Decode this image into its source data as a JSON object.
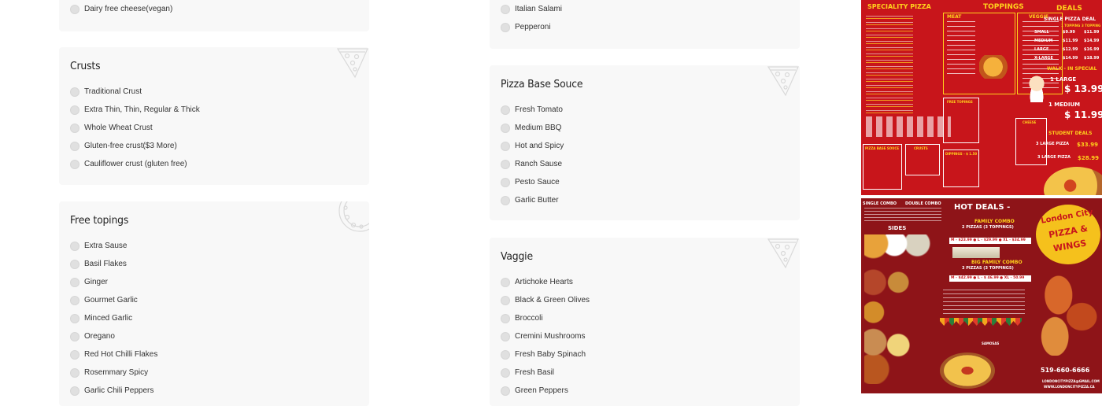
{
  "left_column": {
    "top_partial_option": "Dairy free cheese(vegan)",
    "crusts": {
      "title": "Crusts",
      "options": [
        "Traditional Crust",
        "Extra Thin, Thin, Regular & Thick",
        "Whole Wheat Crust",
        "Gluten-free crust($3 More)",
        "Cauliflower crust (gluten free)"
      ]
    },
    "free_toppings": {
      "title": "Free topings",
      "options": [
        "Extra Sause",
        "Basil Flakes",
        "Ginger",
        "Gourmet Garlic",
        "Minced Garlic",
        "Oregano",
        "Red Hot Chilli Flakes",
        "Rosemmary Spicy",
        "Garlic Chili Peppers"
      ]
    }
  },
  "right_column": {
    "top_partial_options": [
      "Italian Salami",
      "Pepperoni"
    ],
    "pizza_base_sauce": {
      "title": "Pizza Base Souce",
      "options": [
        "Fresh Tomato",
        "Medium BBQ",
        "Hot and Spicy",
        "Ranch Sause",
        "Pesto Sauce",
        "Garlic Butter"
      ]
    },
    "veggie": {
      "title": "Vaggie",
      "options": [
        "Artichoke Hearts",
        "Black & Green Olives",
        "Broccoli",
        "Cremini Mushrooms",
        "Fresh Baby Spinach",
        "Fresh Basil",
        "Green Peppers"
      ]
    }
  },
  "flyer_top": {
    "speciality": "SPECIALITY PIZZA",
    "toppings": "TOPPINGS",
    "meat": "MEAT",
    "veggie": "VEGGIE",
    "deals": "DEALS",
    "single_pizza_deal": "SINGLE PIZZA DEAL",
    "deal_headers": [
      "1 TOPPING",
      "3 TOPPING"
    ],
    "deal_rows": [
      {
        "size": "SMALL",
        "one": "$9.99",
        "three": "$11.99"
      },
      {
        "size": "MEDIUM",
        "one": "$11.99",
        "three": "$14.99"
      },
      {
        "size": "LARGE",
        "one": "$12.99",
        "three": "$16.99"
      },
      {
        "size": "X-LARGE",
        "one": "$14.99",
        "three": "$18.99"
      }
    ],
    "walk_in": "WALK - IN SPECIAL",
    "large_label": "1 LARGE",
    "large_price": "$ 13.99",
    "medium_label": "1 MEDIUM",
    "medium_price": "$ 11.99",
    "student_deals": "STUDENT DEALS",
    "student_rows": [
      {
        "label": "3 LARGE PIZZA",
        "price": "$33.99"
      },
      {
        "label": "3 LARGE PIZZA",
        "price": "$28.99"
      }
    ],
    "pizza_base_sauce": "PIZZA BASE SOUCE",
    "crusts": "CRUSTS",
    "free_topings": "FREE TOPINGS",
    "cheese": "CHEESE",
    "dippings": "DIPPINGS - $ 1.50"
  },
  "flyer_bottom": {
    "single_combo": "SINGLE COMBO",
    "double_combo": "DOUBLE COMBO",
    "sides": "SIDES",
    "hot_deals": "HOT DEALS -",
    "family_combo": "FAMILY COMBO",
    "family_sub": "2 PIZZAS (3 TOPPINGS)",
    "family_prices": "M - $23.99 ● L - $29.99 ● XL - $34.99",
    "big_family_combo": "BIG FAMILY COMBO",
    "big_family_sub": "3 PIZZAS (3 TOPPINGS)",
    "big_family_prices": "M - $42.99 ● L - $ 46.99 ● XL - 50.99",
    "brand_line1": "London City",
    "brand_line2": "PIZZA &",
    "brand_line3": "WINGS",
    "phone": "519-660-6666",
    "email": "LONDONCITYPIZZA@GMAIL.COM",
    "website": "WWW.LONDONCITYPIZZA.CA",
    "samosas": "SAMOSAS"
  },
  "colors": {
    "card_bg": "#f8f8f8",
    "radio_bg": "#e0e0e0",
    "flyer_red": "#c8151b",
    "flyer_dark_red": "#8e1418",
    "flyer_yellow": "#ffd21c"
  }
}
